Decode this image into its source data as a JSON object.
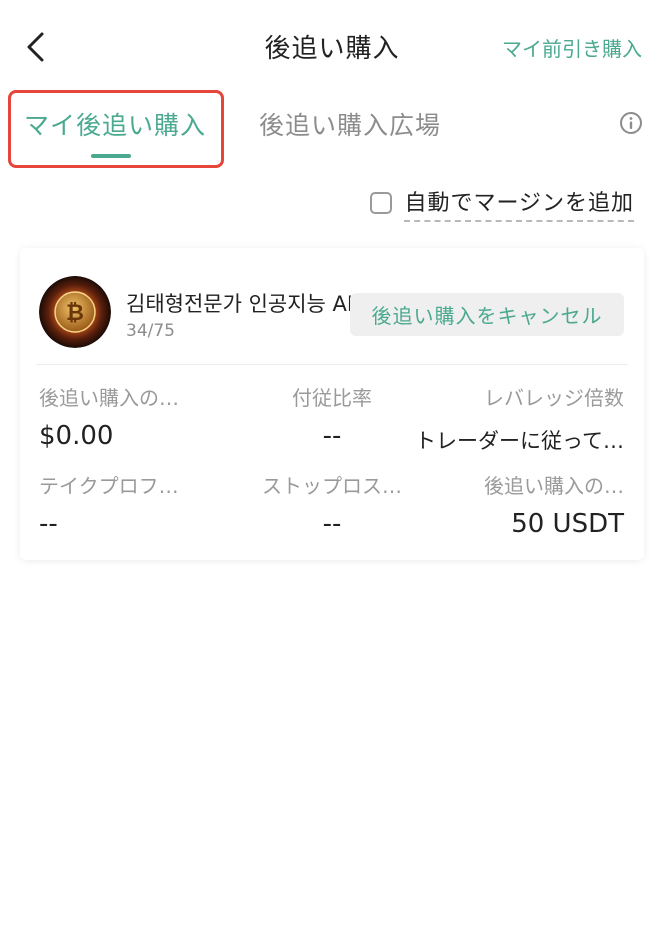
{
  "header": {
    "title": "後追い購入",
    "right_link": "マイ前引き購入"
  },
  "tabs": [
    {
      "label": "マイ後追い購入",
      "active": true
    },
    {
      "label": "後追い購入広場",
      "active": false
    }
  ],
  "options": {
    "auto_margin_label": "自動でマージンを追加",
    "auto_margin_checked": false
  },
  "card": {
    "trader_name": "김태형전문가 인공지능 AI",
    "follower_count": "34/75",
    "cancel_button": "後追い購入をキャンセル",
    "stats": [
      {
        "label": "後追い購入の…",
        "value": "$0.00"
      },
      {
        "label": "付従比率",
        "value": "--"
      },
      {
        "label": "レバレッジ倍数",
        "value": "トレーダーに従って…"
      },
      {
        "label": "テイクプロフ…",
        "value": "--"
      },
      {
        "label": "ストップロス…",
        "value": "--"
      },
      {
        "label": "後追い購入の…",
        "value": "50 USDT"
      }
    ]
  },
  "colors": {
    "accent": "#4aa98f",
    "highlight_box": "#e6463a"
  },
  "icons": {
    "back": "chevron-left-icon",
    "info": "info-icon",
    "avatar": "bitcoin-avatar"
  }
}
